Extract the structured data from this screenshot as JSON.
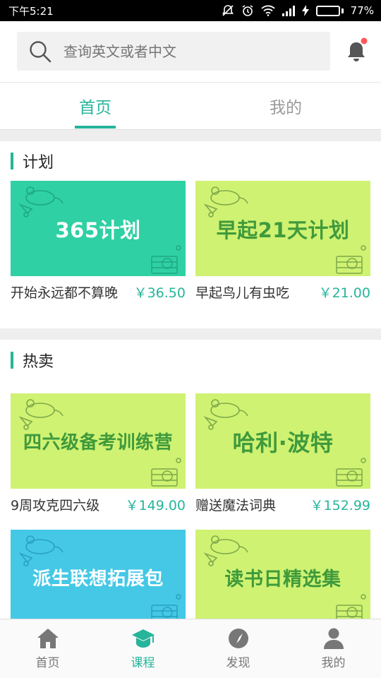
{
  "status_bar": {
    "time": "下午5:21",
    "battery": "77%",
    "battery_level": 0.77
  },
  "search": {
    "placeholder": "查询英文或者中文"
  },
  "colors": {
    "accent": "#26b59b",
    "teal_banner": "#2fd0a3",
    "lime_banner": "#cff272",
    "blue_banner": "#44c8e6",
    "notify_dot": "#ff5a5a"
  },
  "tabs": [
    {
      "label": "首页",
      "active": true
    },
    {
      "label": "我的",
      "active": false
    }
  ],
  "sections": [
    {
      "title": "计划",
      "cards": [
        {
          "banner": "365计划",
          "name": "开始永远都不算晚",
          "price": "￥36.50"
        },
        {
          "banner": "早起21天计划",
          "name": "早起鸟儿有虫吃",
          "price": "￥21.00"
        }
      ]
    },
    {
      "title": "热卖",
      "cards": [
        {
          "banner": "四六级备考训练营",
          "name": "9周攻克四六级",
          "price": "￥149.00"
        },
        {
          "banner": "哈利·波特",
          "name": "赠送魔法词典",
          "price": "￥152.99"
        },
        {
          "banner": "派生联想拓展包",
          "name": "",
          "price": ""
        },
        {
          "banner": "读书日精选集",
          "name": "",
          "price": ""
        }
      ]
    }
  ],
  "bottom_nav": [
    {
      "label": "首页",
      "icon": "home-icon",
      "active": false
    },
    {
      "label": "课程",
      "icon": "graduation-cap-icon",
      "active": true
    },
    {
      "label": "发现",
      "icon": "compass-icon",
      "active": false
    },
    {
      "label": "我的",
      "icon": "person-icon",
      "active": false
    }
  ]
}
